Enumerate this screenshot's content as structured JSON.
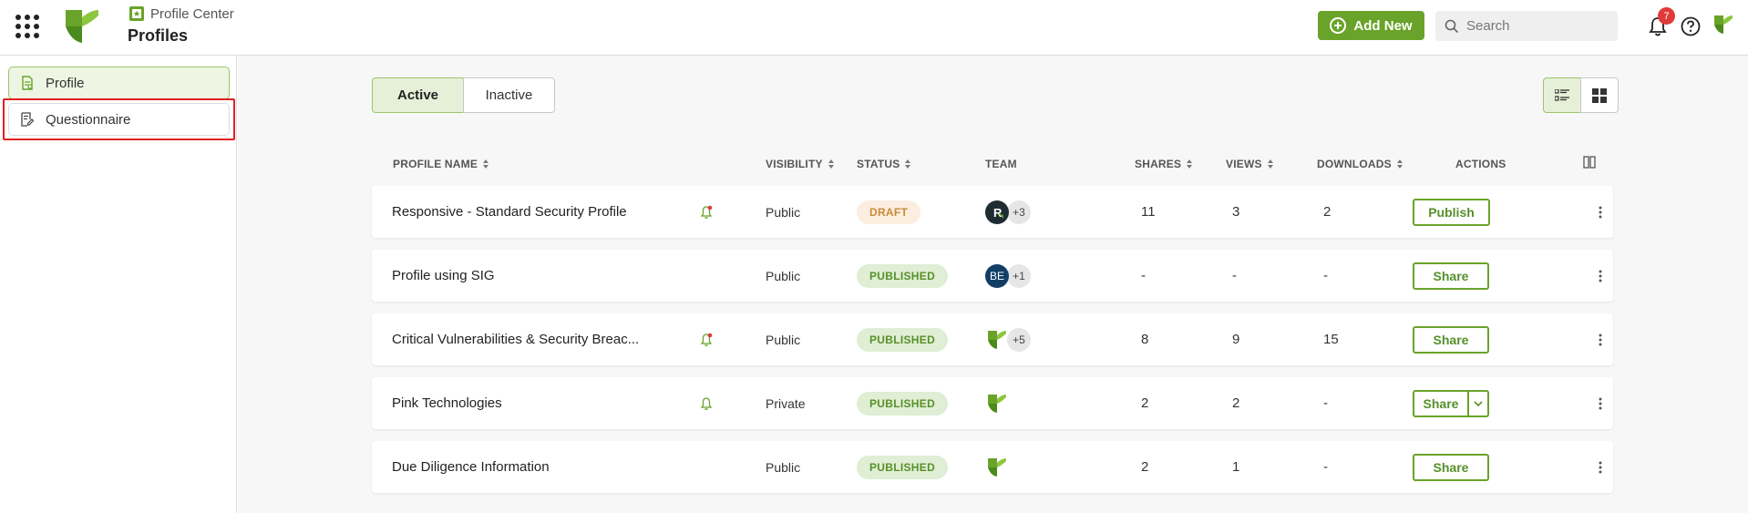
{
  "header": {
    "breadcrumb": "Profile Center",
    "title": "Profiles",
    "add_new_label": "Add New",
    "search_placeholder": "Search",
    "notification_count": "7",
    "brand_color": "#6aa32a"
  },
  "sidebar": {
    "items": [
      {
        "label": "Profile",
        "icon": "document-icon",
        "active": true
      },
      {
        "label": "Questionnaire",
        "icon": "edit-document-icon",
        "active": false
      }
    ]
  },
  "tabs": [
    {
      "label": "Active",
      "selected": true
    },
    {
      "label": "Inactive",
      "selected": false
    }
  ],
  "table": {
    "columns": {
      "profile_name": "PROFILE NAME",
      "visibility": "VISIBILITY",
      "status": "STATUS",
      "team": "TEAM",
      "shares": "SHARES",
      "views": "VIEWS",
      "downloads": "DOWNLOADS",
      "actions": "ACTIONS"
    },
    "rows": [
      {
        "name": "Responsive - Standard Security Profile",
        "bell": "alert",
        "visibility": "Public",
        "status": "DRAFT",
        "team_more": "+3",
        "team_avatar": "R",
        "shares": "11",
        "views": "3",
        "downloads": "2",
        "action": "Publish"
      },
      {
        "name": "Profile using SIG",
        "bell": "none",
        "visibility": "Public",
        "status": "PUBLISHED",
        "team_more": "+1",
        "team_avatar": "BE",
        "shares": "-",
        "views": "-",
        "downloads": "-",
        "action": "Share"
      },
      {
        "name": "Critical Vulnerabilities & Security Breac...",
        "bell": "alert",
        "visibility": "Public",
        "status": "PUBLISHED",
        "team_more": "+5",
        "team_avatar": "",
        "shares": "8",
        "views": "9",
        "downloads": "15",
        "action": "Share"
      },
      {
        "name": "Pink Technologies",
        "bell": "plain",
        "visibility": "Private",
        "status": "PUBLISHED",
        "team_more": "",
        "team_avatar": "",
        "shares": "2",
        "views": "2",
        "downloads": "-",
        "action": "Share"
      },
      {
        "name": "Due Diligence Information",
        "bell": "none",
        "visibility": "Public",
        "status": "PUBLISHED",
        "team_more": "",
        "team_avatar": "",
        "shares": "2",
        "views": "1",
        "downloads": "-",
        "action": "Share"
      }
    ]
  }
}
